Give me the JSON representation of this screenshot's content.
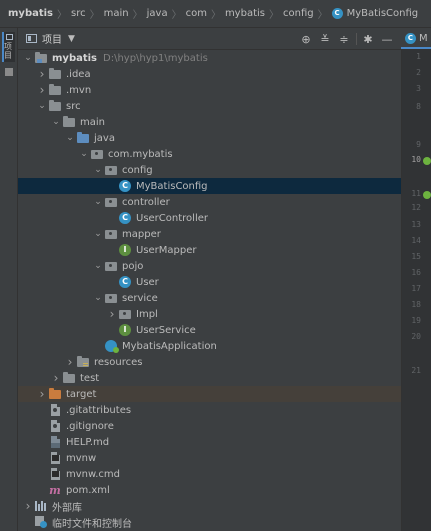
{
  "breadcrumb": {
    "items": [
      "mybatis",
      "src",
      "main",
      "java",
      "com",
      "mybatis",
      "config",
      "MyBatisConfig"
    ],
    "separator": "〉",
    "class_icon_letter": "C"
  },
  "tool_strip": {
    "project_tab_label": "项目"
  },
  "panel": {
    "title": "项目",
    "dropdown_glyph": "▼",
    "tools": [
      {
        "name": "locate-icon",
        "glyph": "⊕"
      },
      {
        "name": "expand-all-icon",
        "glyph": "≚"
      },
      {
        "name": "collapse-all-icon",
        "glyph": "≑"
      },
      {
        "name": "settings-gear-icon",
        "glyph": "✱"
      },
      {
        "name": "hide-icon",
        "glyph": "—"
      }
    ]
  },
  "tree": {
    "rows": [
      {
        "label": "mybatis",
        "path": "D:\\hyp\\hyp1\\mybatis",
        "indent": 0,
        "arrow": "open",
        "icon": "module-folder",
        "bold": true
      },
      {
        "label": ".idea",
        "indent": 1,
        "arrow": "closed",
        "icon": "folder"
      },
      {
        "label": ".mvn",
        "indent": 1,
        "arrow": "closed",
        "icon": "folder"
      },
      {
        "label": "src",
        "indent": 1,
        "arrow": "open",
        "icon": "folder"
      },
      {
        "label": "main",
        "indent": 2,
        "arrow": "open",
        "icon": "folder"
      },
      {
        "label": "java",
        "indent": 3,
        "arrow": "open",
        "icon": "source-folder"
      },
      {
        "label": "com.mybatis",
        "indent": 4,
        "arrow": "open",
        "icon": "package"
      },
      {
        "label": "config",
        "indent": 5,
        "arrow": "open",
        "icon": "package"
      },
      {
        "label": "MyBatisConfig",
        "indent": 6,
        "arrow": "none",
        "icon": "class",
        "selected": true
      },
      {
        "label": "controller",
        "indent": 5,
        "arrow": "open",
        "icon": "package"
      },
      {
        "label": "UserController",
        "indent": 6,
        "arrow": "none",
        "icon": "class"
      },
      {
        "label": "mapper",
        "indent": 5,
        "arrow": "open",
        "icon": "package"
      },
      {
        "label": "UserMapper",
        "indent": 6,
        "arrow": "none",
        "icon": "interface"
      },
      {
        "label": "pojo",
        "indent": 5,
        "arrow": "open",
        "icon": "package"
      },
      {
        "label": "User",
        "indent": 6,
        "arrow": "none",
        "icon": "class"
      },
      {
        "label": "service",
        "indent": 5,
        "arrow": "open",
        "icon": "package"
      },
      {
        "label": "Impl",
        "indent": 6,
        "arrow": "closed",
        "icon": "package"
      },
      {
        "label": "UserService",
        "indent": 6,
        "arrow": "none",
        "icon": "interface"
      },
      {
        "label": "MybatisApplication",
        "indent": 5,
        "arrow": "none",
        "icon": "spring-boot-class"
      },
      {
        "label": "resources",
        "indent": 3,
        "arrow": "closed",
        "icon": "resources-folder"
      },
      {
        "label": "test",
        "indent": 2,
        "arrow": "closed",
        "icon": "folder"
      },
      {
        "label": "target",
        "indent": 1,
        "arrow": "closed",
        "icon": "excluded-folder",
        "excluded": true
      },
      {
        "label": ".gitattributes",
        "indent": 1,
        "arrow": "none",
        "icon": "git-file"
      },
      {
        "label": ".gitignore",
        "indent": 1,
        "arrow": "none",
        "icon": "git-file"
      },
      {
        "label": "HELP.md",
        "indent": 1,
        "arrow": "none",
        "icon": "markdown-file"
      },
      {
        "label": "mvnw",
        "indent": 1,
        "arrow": "none",
        "icon": "script-file"
      },
      {
        "label": "mvnw.cmd",
        "indent": 1,
        "arrow": "none",
        "icon": "script-file"
      },
      {
        "label": "pom.xml",
        "indent": 1,
        "arrow": "none",
        "icon": "maven-file"
      },
      {
        "label": "外部库",
        "indent": 0,
        "arrow": "closed",
        "icon": "libraries"
      },
      {
        "label": "临时文件和控制台",
        "indent": 0,
        "arrow": "none",
        "icon": "scratches"
      }
    ]
  },
  "editor": {
    "tab_label": "M",
    "tab_icon_letter": "C",
    "line_numbers": [
      "1",
      "2",
      "3",
      "8",
      "9",
      "10",
      "11",
      "12",
      "13",
      "14",
      "15",
      "16",
      "17",
      "18",
      "19",
      "20",
      "21"
    ],
    "current_line": "10",
    "bean_lines": [
      "10",
      "11"
    ]
  },
  "colors": {
    "background": "#3c3f41",
    "selection": "#0d293e",
    "class_icon": "#3592c4",
    "interface_icon": "#5d8f3f",
    "excluded_folder": "#c97c3e",
    "spring": "#6db33f"
  }
}
